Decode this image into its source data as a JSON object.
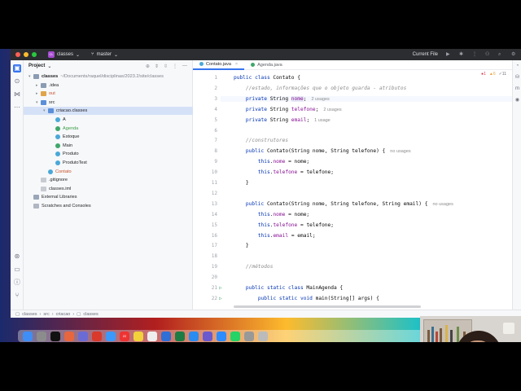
{
  "titlebar": {
    "project_badge": "CL",
    "project_name": "classes",
    "branch_name": "master",
    "run_config": "Current File"
  },
  "project_panel": {
    "title": "Project",
    "tree": [
      {
        "label": "classes",
        "hint": "~/Documents/raquel/disciplinas/2023.2/site/classes",
        "kind": "folder",
        "depth": 0,
        "open": true
      },
      {
        "label": ".idea",
        "kind": "folder",
        "depth": 1,
        "open": false
      },
      {
        "label": "out",
        "kind": "folder-orange",
        "depth": 1,
        "open": false
      },
      {
        "label": "src",
        "kind": "folder-src",
        "depth": 1,
        "open": true
      },
      {
        "label": "criacao.classes",
        "kind": "package",
        "depth": 2,
        "open": true,
        "selected": true
      },
      {
        "label": "A",
        "kind": "class",
        "depth": 3
      },
      {
        "label": "Agenda",
        "kind": "class-green",
        "depth": 3
      },
      {
        "label": "Estoque",
        "kind": "class",
        "depth": 3
      },
      {
        "label": "Main",
        "kind": "class-main",
        "depth": 3
      },
      {
        "label": "Produto",
        "kind": "class",
        "depth": 3
      },
      {
        "label": "ProdutoTest",
        "kind": "class",
        "depth": 3
      },
      {
        "label": "Contato",
        "kind": "class-orange",
        "depth": 2
      },
      {
        "label": ".gitignore",
        "kind": "file",
        "depth": 1
      },
      {
        "label": "classes.iml",
        "kind": "file",
        "depth": 1
      },
      {
        "label": "External Libraries",
        "kind": "lib",
        "depth": 0
      },
      {
        "label": "Scratches and Consoles",
        "kind": "scratch",
        "depth": 0
      }
    ]
  },
  "editor": {
    "tabs": [
      {
        "label": "Contato.java",
        "active": true
      },
      {
        "label": "Agenda.java",
        "active": false
      }
    ],
    "inspections": {
      "errors": "1",
      "warnings": "6",
      "weak": "11"
    },
    "lines": [
      {
        "n": "1",
        "html": "<span class=\"kw\">public class</span> Contato {"
      },
      {
        "n": "2",
        "html": "    <span class=\"cmt\">//estado, informações que o objeto guarda - atributos</span>"
      },
      {
        "n": "3",
        "html": "    <span class=\"kw\">private</span> String <span class=\"fld hl\">nome</span>;<span class=\"usages\">2 usages</span>",
        "current": true
      },
      {
        "n": "4",
        "html": "    <span class=\"kw\">private</span> String <span class=\"fld\">telefone</span>;<span class=\"usages\">2 usages</span>"
      },
      {
        "n": "5",
        "html": "    <span class=\"kw\">private</span> String <span class=\"fld\">email</span>;<span class=\"usages\">1 usage</span>"
      },
      {
        "n": "6",
        "html": ""
      },
      {
        "n": "7",
        "html": "    <span class=\"cmt\">//construtores</span>"
      },
      {
        "n": "8",
        "html": "    <span class=\"kw\">public</span> Contato(String nome, String telefone) {<span class=\"usages\">no usages</span>"
      },
      {
        "n": "9",
        "html": "        <span class=\"kw\">this</span>.<span class=\"fld\">nome</span> = nome;"
      },
      {
        "n": "10",
        "html": "        <span class=\"kw\">this</span>.<span class=\"fld\">telefone</span> = telefone;"
      },
      {
        "n": "11",
        "html": "    }"
      },
      {
        "n": "12",
        "html": ""
      },
      {
        "n": "13",
        "html": "    <span class=\"kw\">public</span> Contato(String nome, String telefone, String email) {<span class=\"usages\">no usages</span>"
      },
      {
        "n": "14",
        "html": "        <span class=\"kw\">this</span>.<span class=\"fld\">nome</span> = nome;"
      },
      {
        "n": "15",
        "html": "        <span class=\"kw\">this</span>.<span class=\"fld\">telefone</span> = telefone;"
      },
      {
        "n": "16",
        "html": "        <span class=\"kw\">this</span>.<span class=\"fld\">email</span> = email;"
      },
      {
        "n": "17",
        "html": "    }"
      },
      {
        "n": "18",
        "html": ""
      },
      {
        "n": "19",
        "html": "    <span class=\"cmt\">//métodos</span>"
      },
      {
        "n": "20",
        "html": ""
      },
      {
        "n": "21",
        "html": "    <span class=\"kw\">public static class</span> MainAgenda {",
        "run": true
      },
      {
        "n": "22",
        "html": "        <span class=\"kw\">public static void</span> main(String[] args) {",
        "run": true
      }
    ]
  },
  "statusbar": {
    "crumbs": [
      "classes",
      "src",
      "criacao",
      "classes"
    ]
  },
  "dock": {
    "calendar_month": "AUG",
    "calendar_day": "22"
  },
  "colors": {
    "accent": "#3574f0",
    "keyword": "#0033b3",
    "field": "#871094",
    "comment": "#8c8c8c"
  }
}
